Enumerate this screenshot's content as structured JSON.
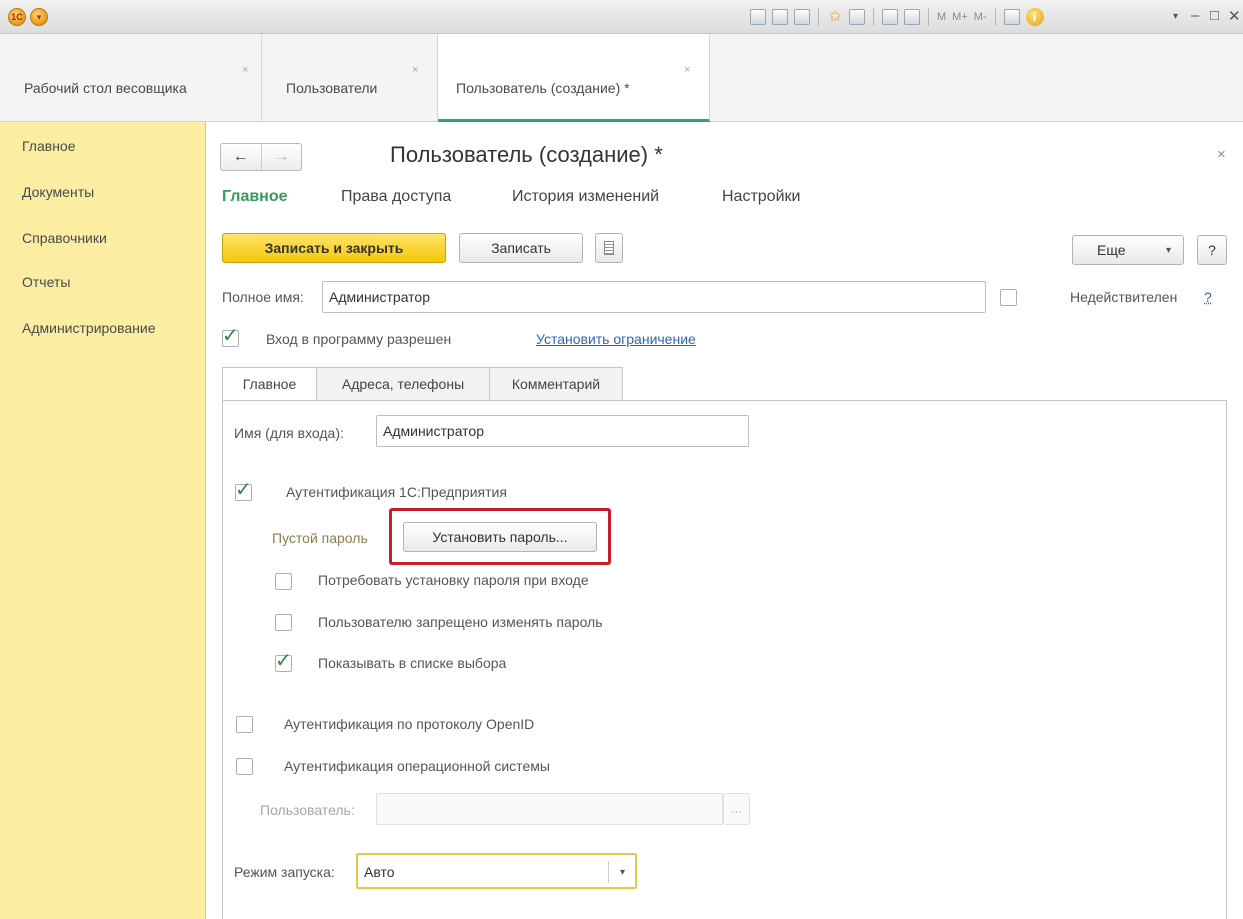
{
  "titlebar": {
    "memory_buttons": [
      "M",
      "M+",
      "M-"
    ],
    "icons": [
      "save-icon",
      "print-icon",
      "preview-icon",
      "favorite-icon",
      "document-icon",
      "calculator-icon",
      "calendar-icon",
      "panels-icon",
      "info-icon"
    ],
    "window_controls": [
      "dropdown",
      "minimize",
      "maximize",
      "close"
    ]
  },
  "section_tabs": [
    {
      "label": "Рабочий стол весовщика",
      "active": false
    },
    {
      "label": "Пользователи",
      "active": false
    },
    {
      "label": "Пользователь (создание) *",
      "active": true
    }
  ],
  "left_nav": [
    "Главное",
    "Документы",
    "Справочники",
    "Отчеты",
    "Администрирование"
  ],
  "form": {
    "title": "Пользователь (создание) *",
    "tabs": [
      {
        "label": "Главное",
        "active": true
      },
      {
        "label": "Права доступа",
        "active": false
      },
      {
        "label": "История изменений",
        "active": false
      },
      {
        "label": "Настройки",
        "active": false
      }
    ],
    "toolbar": {
      "save_close": "Записать и закрыть",
      "save": "Записать",
      "more": "Еще",
      "help": "?"
    },
    "full_name_label": "Полное имя:",
    "full_name_value": "Администратор",
    "invalid_label": "Недействителен",
    "invalid_checked": false,
    "invalid_help": "?",
    "login_allowed_label": "Вход в программу разрешен",
    "login_allowed_checked": true,
    "set_restriction_link": "Установить ограничение",
    "page_tabs": [
      {
        "label": "Главное",
        "active": true
      },
      {
        "label": "Адреса, телефоны",
        "active": false
      },
      {
        "label": "Комментарий",
        "active": false
      }
    ],
    "login_name_label": "Имя (для входа):",
    "login_name_value": "Администратор",
    "auth_1c_label": "Аутентификация 1С:Предприятия",
    "auth_1c_checked": true,
    "empty_password_label": "Пустой пароль",
    "set_password_button": "Установить пароль...",
    "require_password_change_label": "Потребовать установку пароля при входе",
    "require_password_change_checked": false,
    "forbid_password_change_label": "Пользователю запрещено изменять пароль",
    "forbid_password_change_checked": false,
    "show_in_list_label": "Показывать в списке выбора",
    "show_in_list_checked": true,
    "auth_openid_label": "Аутентификация по протоколу OpenID",
    "auth_openid_checked": false,
    "auth_os_label": "Аутентификация операционной системы",
    "auth_os_checked": false,
    "os_user_label": "Пользователь:",
    "os_user_value": "",
    "os_user_button": "...",
    "launch_mode_label": "Режим запуска:",
    "launch_mode_value": "Авто"
  },
  "colors": {
    "accent_green": "#3a9a5c",
    "primary_button": "#f5c808",
    "left_panel": "#fbeea3",
    "highlight_box": "#c81d25",
    "link": "#2a67b7"
  }
}
